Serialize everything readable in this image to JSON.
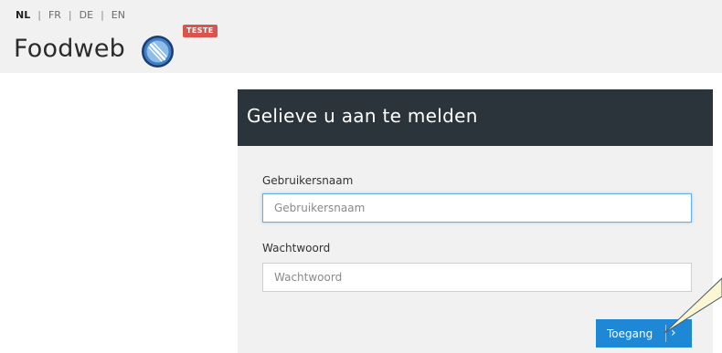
{
  "languages": [
    {
      "code": "NL",
      "active": true
    },
    {
      "code": "FR",
      "active": false
    },
    {
      "code": "DE",
      "active": false
    },
    {
      "code": "EN",
      "active": false
    }
  ],
  "separator": "|",
  "brand": {
    "name": "Foodweb",
    "badge": "TESTE",
    "badge_color": "#d9534f",
    "logo_icon": "fork-knife-circle-icon"
  },
  "login": {
    "title": "Gelieve u aan te melden",
    "username_label": "Gebruikersnaam",
    "username_placeholder": "Gebruikersnaam",
    "username_value": "",
    "password_label": "Wachtwoord",
    "password_placeholder": "Wachtwoord",
    "password_value": "",
    "submit_label": "Toegang",
    "submit_icon": "chevron-right-icon"
  },
  "colors": {
    "header_dark": "#2b333b",
    "accent": "#1e88d6",
    "focus_border": "#66afe9",
    "background": "#f1f1f1"
  }
}
